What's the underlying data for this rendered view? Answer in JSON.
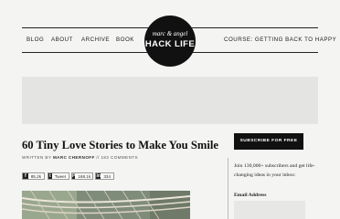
{
  "nav": {
    "blog": "BLOG",
    "about": "ABOUT",
    "archive": "ARCHIVE",
    "book": "BOOK",
    "course": "COURSE: GETTING BACK TO HAPPY"
  },
  "logo": {
    "top_text": "marc & angel",
    "bottom_text": "HACK LIFE"
  },
  "article": {
    "title": "60 Tiny Love Stories to Make You Smile",
    "byline_prefix": "WRITTEN BY",
    "author": "MARC CHERNOFF",
    "byline_sep": "//",
    "comments": "182 COMMENTS"
  },
  "share": [
    {
      "icon": "facebook-icon",
      "glyph": "f",
      "count": "85.2k"
    },
    {
      "icon": "twitter-icon",
      "glyph": "t",
      "count": "Tweet"
    },
    {
      "icon": "pinterest-icon",
      "glyph": "P",
      "count": "168.1k"
    },
    {
      "icon": "linkedin-icon",
      "glyph": "in",
      "count": "334"
    }
  ],
  "sidebar": {
    "subscribe_label": "SUBSCRIBE FOR FREE",
    "pitch": "Join 130,000+ subscribers and get life-changing ideas in your inbox:",
    "email_label": "Email Address"
  },
  "colors": {
    "background": "#f4f4f2",
    "accent": "#111111",
    "ad_band": "#e4e4e2"
  }
}
